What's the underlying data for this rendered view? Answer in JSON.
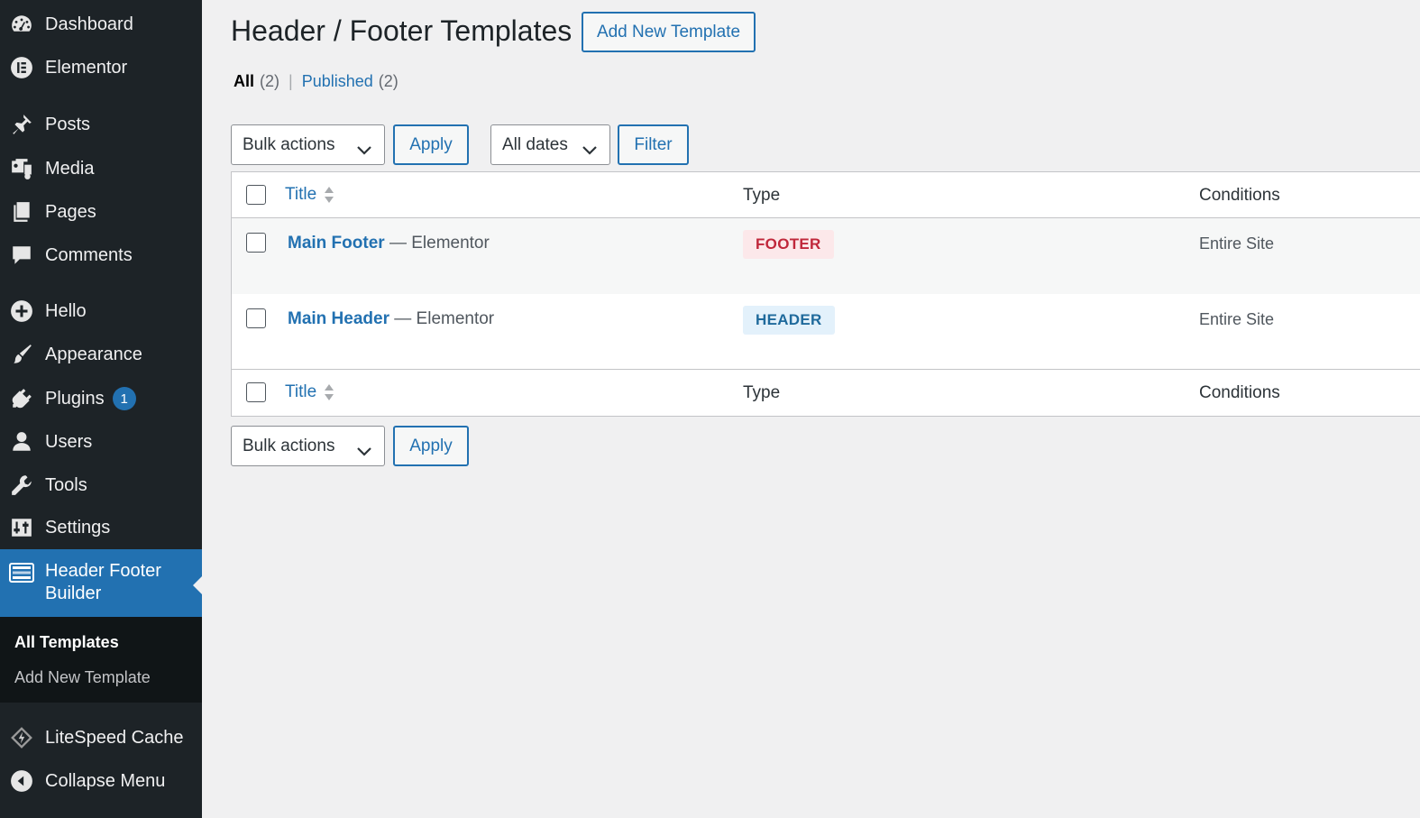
{
  "sidebar": {
    "items": [
      {
        "label": "Dashboard",
        "icon": "dashboard-icon"
      },
      {
        "label": "Elementor",
        "icon": "elementor-icon"
      },
      {
        "label": "Posts",
        "icon": "pin-icon"
      },
      {
        "label": "Media",
        "icon": "media-icon"
      },
      {
        "label": "Pages",
        "icon": "pages-icon"
      },
      {
        "label": "Comments",
        "icon": "comment-icon"
      },
      {
        "label": "Hello",
        "icon": "plus-circle-icon"
      },
      {
        "label": "Appearance",
        "icon": "paintbrush-icon"
      },
      {
        "label": "Plugins",
        "icon": "plug-icon",
        "badge": "1"
      },
      {
        "label": "Users",
        "icon": "user-icon"
      },
      {
        "label": "Tools",
        "icon": "wrench-icon"
      },
      {
        "label": "Settings",
        "icon": "settings-icon"
      }
    ],
    "active": {
      "label": "Header Footer Builder",
      "icon": "header-footer-icon"
    },
    "submenu": [
      {
        "label": "All Templates",
        "current": true
      },
      {
        "label": "Add New Template",
        "current": false
      }
    ],
    "bottom_items": [
      {
        "label": "LiteSpeed Cache",
        "icon": "litespeed-icon"
      },
      {
        "label": "Collapse Menu",
        "icon": "collapse-icon"
      }
    ]
  },
  "main": {
    "title": "Header / Footer Templates",
    "add_new_label": "Add New Template",
    "views": {
      "all_label": "All",
      "all_count": "(2)",
      "separator": "|",
      "published_label": "Published",
      "published_count": "(2)"
    },
    "top_bulk": {
      "select": "Bulk actions",
      "apply": "Apply"
    },
    "dates_filter": {
      "select": "All dates",
      "filter": "Filter"
    },
    "bottom_bulk": {
      "select": "Bulk actions",
      "apply": "Apply"
    },
    "table": {
      "columns": {
        "title": "Title",
        "type": "Type",
        "conditions": "Conditions"
      },
      "rows": [
        {
          "title": "Main Footer",
          "suffix": "— Elementor",
          "type": "FOOTER",
          "conditions": "Entire Site"
        },
        {
          "title": "Main Header",
          "suffix": "— Elementor",
          "type": "HEADER",
          "conditions": "Entire Site"
        }
      ]
    }
  },
  "colors": {
    "sidebar_bg": "#1d2327",
    "accent": "#2271b1",
    "footer_tag": "#c0273b",
    "header_tag": "#1f6a9c"
  }
}
